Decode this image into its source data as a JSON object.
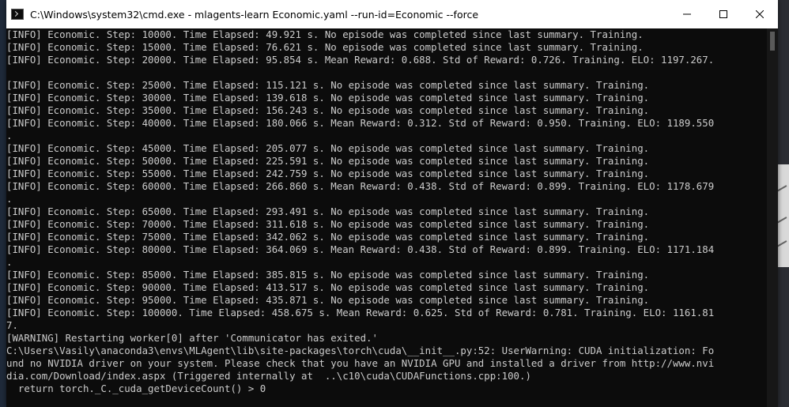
{
  "window": {
    "title": "C:\\Windows\\system32\\cmd.exe - mlagents-learn  Economic.yaml --run-id=Economic --force"
  },
  "controls": {
    "minimize": "minimize-icon",
    "maximize": "maximize-icon",
    "close": "close-icon"
  },
  "console": {
    "lines": [
      "[INFO] Economic. Step: 10000. Time Elapsed: 49.921 s. No episode was completed since last summary. Training.",
      "[INFO] Economic. Step: 15000. Time Elapsed: 76.621 s. No episode was completed since last summary. Training.",
      "[INFO] Economic. Step: 20000. Time Elapsed: 95.854 s. Mean Reward: 0.688. Std of Reward: 0.726. Training. ELO: 1197.267.",
      "",
      "[INFO] Economic. Step: 25000. Time Elapsed: 115.121 s. No episode was completed since last summary. Training.",
      "[INFO] Economic. Step: 30000. Time Elapsed: 139.618 s. No episode was completed since last summary. Training.",
      "[INFO] Economic. Step: 35000. Time Elapsed: 156.243 s. No episode was completed since last summary. Training.",
      "[INFO] Economic. Step: 40000. Time Elapsed: 180.066 s. Mean Reward: 0.312. Std of Reward: 0.950. Training. ELO: 1189.550",
      ".",
      "[INFO] Economic. Step: 45000. Time Elapsed: 205.077 s. No episode was completed since last summary. Training.",
      "[INFO] Economic. Step: 50000. Time Elapsed: 225.591 s. No episode was completed since last summary. Training.",
      "[INFO] Economic. Step: 55000. Time Elapsed: 242.759 s. No episode was completed since last summary. Training.",
      "[INFO] Economic. Step: 60000. Time Elapsed: 266.860 s. Mean Reward: 0.438. Std of Reward: 0.899. Training. ELO: 1178.679",
      ".",
      "[INFO] Economic. Step: 65000. Time Elapsed: 293.491 s. No episode was completed since last summary. Training.",
      "[INFO] Economic. Step: 70000. Time Elapsed: 311.618 s. No episode was completed since last summary. Training.",
      "[INFO] Economic. Step: 75000. Time Elapsed: 342.062 s. No episode was completed since last summary. Training.",
      "[INFO] Economic. Step: 80000. Time Elapsed: 364.069 s. Mean Reward: 0.438. Std of Reward: 0.899. Training. ELO: 1171.184",
      ".",
      "[INFO] Economic. Step: 85000. Time Elapsed: 385.815 s. No episode was completed since last summary. Training.",
      "[INFO] Economic. Step: 90000. Time Elapsed: 413.517 s. No episode was completed since last summary. Training.",
      "[INFO] Economic. Step: 95000. Time Elapsed: 435.871 s. No episode was completed since last summary. Training.",
      "[INFO] Economic. Step: 100000. Time Elapsed: 458.675 s. Mean Reward: 0.625. Std of Reward: 0.781. Training. ELO: 1161.81",
      "7.",
      "[WARNING] Restarting worker[0] after 'Communicator has exited.'",
      "C:\\Users\\Vasily\\anaconda3\\envs\\MLAgent\\lib\\site-packages\\torch\\cuda\\__init__.py:52: UserWarning: CUDA initialization: Fo",
      "und no NVIDIA driver on your system. Please check that you have an NVIDIA GPU and installed a driver from http://www.nvi",
      "dia.com/Download/index.aspx (Triggered internally at  ..\\c10\\cuda\\CUDAFunctions.cpp:100.)",
      "  return torch._C._cuda_getDeviceCount() > 0"
    ]
  },
  "colors": {
    "console_bg": "#0c0c0c",
    "console_fg": "#cccccc",
    "titlebar_bg": "#ffffff"
  }
}
